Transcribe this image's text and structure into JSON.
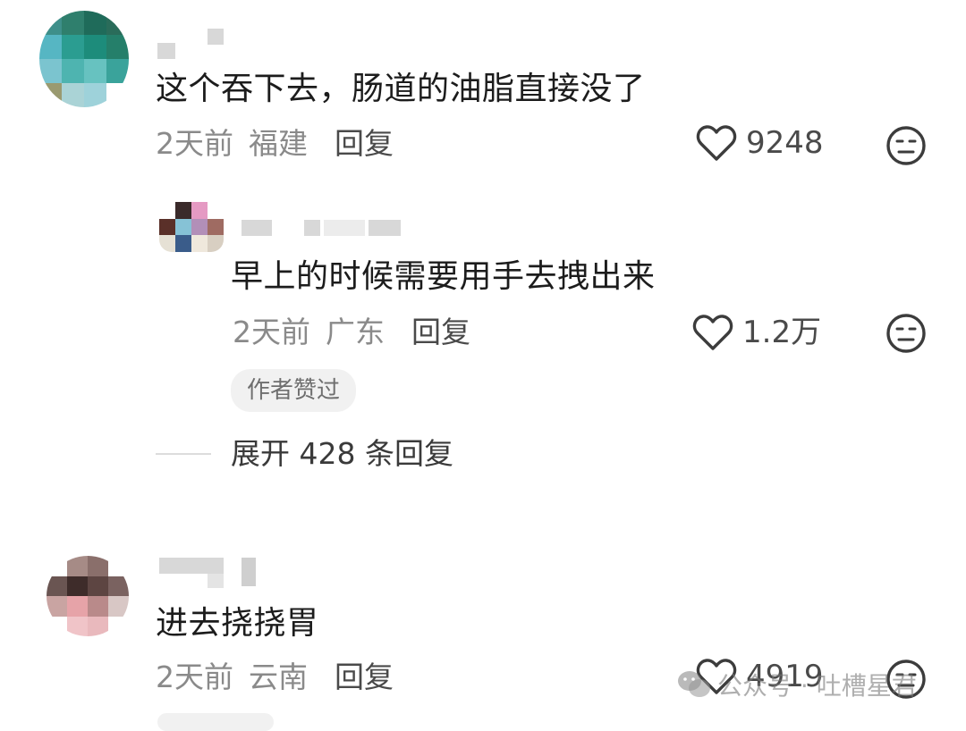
{
  "comments": [
    {
      "text": "这个吞下去，肠道的油脂直接没了",
      "time": "2天前",
      "location": "福建",
      "reply_label": "回复",
      "likes": "9248"
    },
    {
      "text": "进去挠挠胃",
      "time": "2天前",
      "location": "云南",
      "reply_label": "回复",
      "likes": "4919"
    }
  ],
  "reply": {
    "text": "早上的时候需要用手去拽出来",
    "time": "2天前",
    "location": "广东",
    "reply_label": "回复",
    "likes": "1.2万",
    "badge": "作者赞过"
  },
  "expand_replies": "展开 428 条回复",
  "watermark": {
    "text": "公众号 · 吐槽星君"
  },
  "icons": {
    "like": "heart-outline-icon",
    "dislike": "neutral-face-icon",
    "watermark": "wechat-icon"
  },
  "colors": {
    "text": "#1c1c1c",
    "meta": "#8a8a8a",
    "icon": "#3c3c3c"
  }
}
